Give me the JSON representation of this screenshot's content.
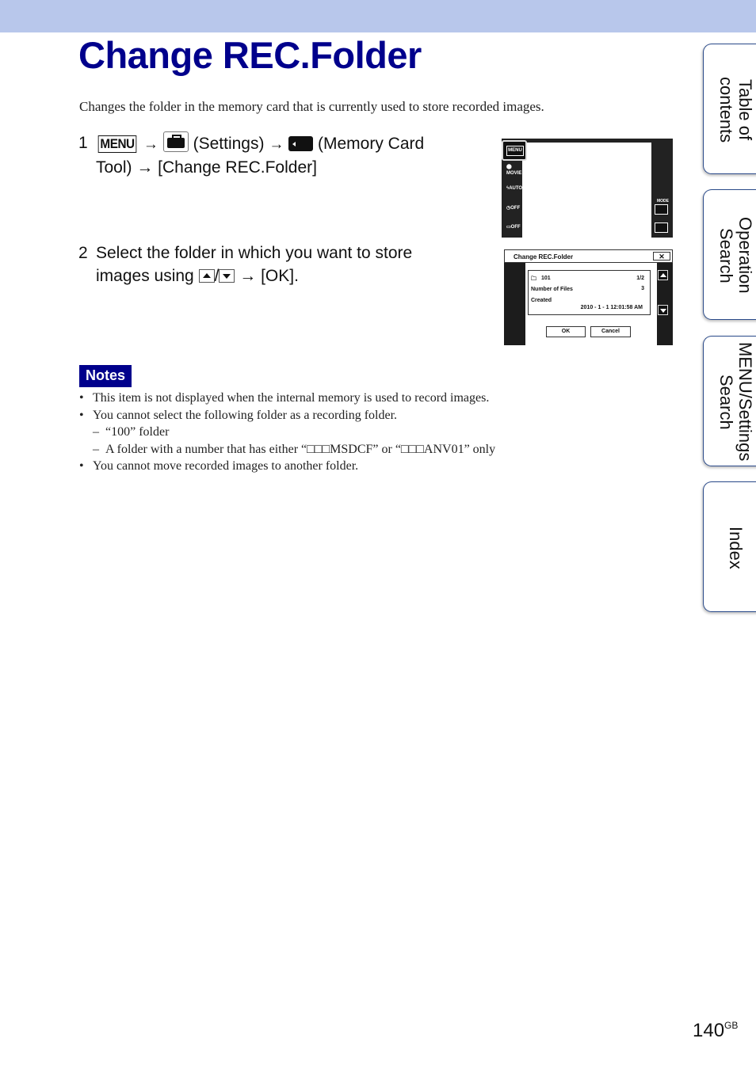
{
  "page": {
    "title": "Change REC.Folder",
    "intro": "Changes the folder in the memory card that is currently used to store recorded images.",
    "page_number": "140",
    "page_suffix": "GB"
  },
  "steps": [
    {
      "number": "1",
      "menu_icon_label": "MENU",
      "arrow": "→",
      "settings_label": "(Settings)",
      "card_label": "(Memory Card",
      "line2": "Tool) → [Change REC.Folder]"
    },
    {
      "number": "2",
      "line1": "Select the folder in which you want to store",
      "line2_prefix": "images using",
      "separator": "/",
      "line2_suffix": "→ [OK]."
    }
  ],
  "screen1": {
    "menu_label": "MENU",
    "icons": [
      "MOVIE",
      "AUTO",
      "OFF",
      "OFF"
    ],
    "mode_label": "MODE"
  },
  "screen2": {
    "title": "Change REC.Folder",
    "close": "✕",
    "folder_name": "101",
    "page": "1/2",
    "files_label": "Number of Files",
    "files_value": "3",
    "created_label": "Created",
    "created_value": "2010 - 1 - 1  12:01:58 AM",
    "ok": "OK",
    "cancel": "Cancel"
  },
  "notes": {
    "badge": "Notes",
    "items": [
      "This item is not displayed when the internal memory is used to record images.",
      "You cannot select the following folder as a recording folder."
    ],
    "sub_items": [
      "“100” folder",
      "A folder with a number that has either “□□□MSDCF” or “□□□ANV01” only"
    ],
    "last_item": "You cannot move recorded images to another folder."
  },
  "side_tabs": [
    {
      "label": "Table of\ncontents"
    },
    {
      "label": "Operation\nSearch"
    },
    {
      "label": "MENU/Settings\nSearch"
    },
    {
      "label": "Index"
    }
  ]
}
